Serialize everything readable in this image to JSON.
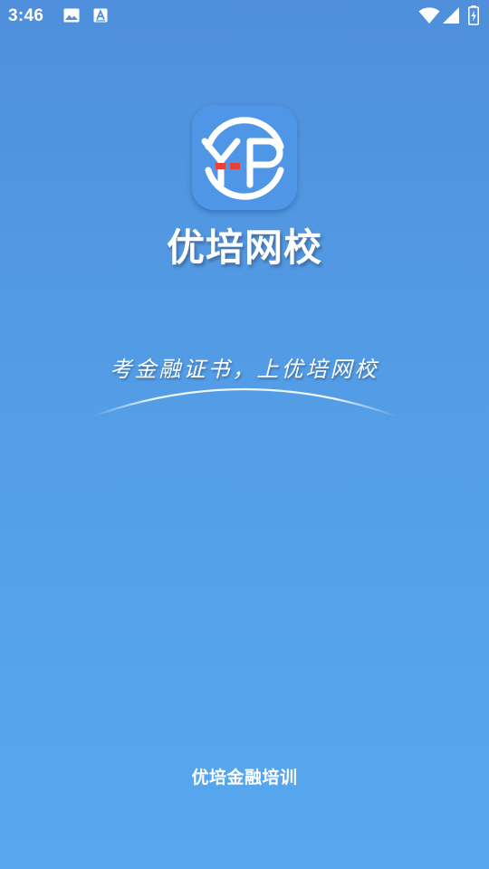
{
  "status_bar": {
    "time": "3:46",
    "icons": [
      "image-icon",
      "text-a-icon",
      "wifi-icon",
      "signal-icon",
      "battery-charging-icon"
    ]
  },
  "splash": {
    "logo_icon": "yp-logo-icon",
    "logo_text": "YP",
    "app_name": "优培网校",
    "slogan": "考金融证书，上优培网校",
    "footer": "优培金融培训"
  },
  "colors": {
    "background_top": "#4f8fdc",
    "background_bottom": "#57a8ef",
    "logo_bg": "#4f97e6",
    "logo_accent": "#e8413a",
    "text": "#ffffff"
  }
}
